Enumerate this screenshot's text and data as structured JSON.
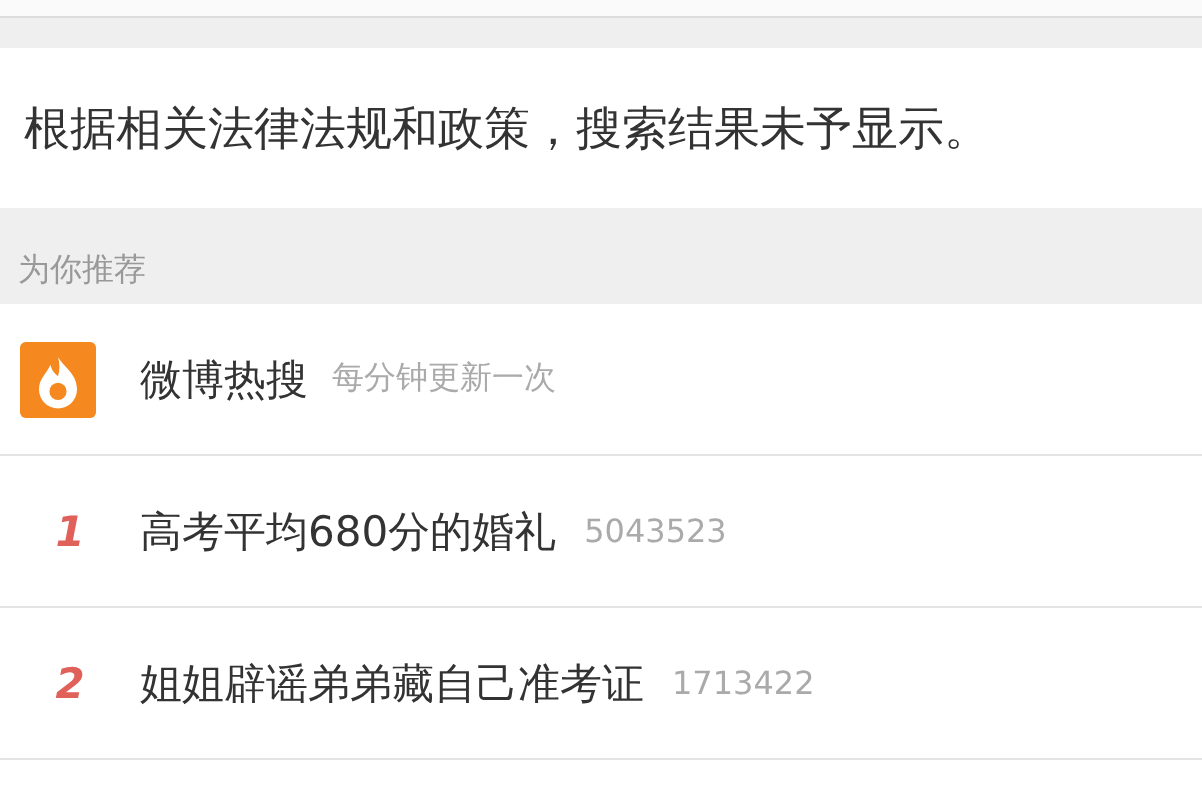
{
  "notice": "根据相关法律法规和政策，搜索结果未予显示。",
  "section_label": "为你推荐",
  "hot_header": {
    "title": "微博热搜",
    "subtitle": "每分钟更新一次"
  },
  "hot_items": [
    {
      "rank": "1",
      "title": "高考平均680分的婚礼",
      "count": "5043523"
    },
    {
      "rank": "2",
      "title": "姐姐辟谣弟弟藏自己准考证",
      "count": "1713422"
    }
  ]
}
